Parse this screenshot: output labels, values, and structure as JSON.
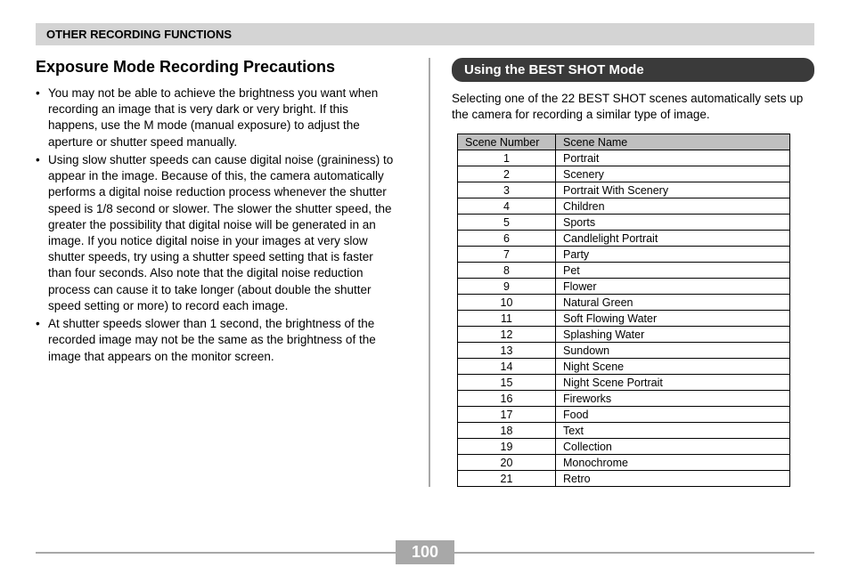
{
  "header": "OTHER RECORDING FUNCTIONS",
  "left": {
    "title": "Exposure Mode Recording Precautions",
    "bullets": [
      "You may not be able to achieve the brightness you want when recording an image that is very dark or very bright. If this happens, use the M mode (manual exposure) to adjust the aperture or shutter speed manually.",
      "Using slow shutter speeds can cause digital noise (graininess) to appear in the image. Because of this, the camera automatically performs a digital noise reduction process whenever the shutter speed is 1/8 second or slower. The slower the shutter speed, the greater the possibility that digital noise will be generated in an image. If you notice digital noise in your images at very slow shutter speeds, try using a shutter speed setting that is faster than four seconds. Also note that the digital noise reduction process can cause it to take longer (about double the shutter speed setting or more) to record each image.",
      "At shutter speeds slower than 1 second, the brightness of the recorded image may not be the same as the brightness of the image that appears on the monitor screen."
    ]
  },
  "right": {
    "subheader": "Using the BEST SHOT Mode",
    "intro": "Selecting one of the 22 BEST SHOT scenes automatically sets up the camera for recording a similar type of image.",
    "table": {
      "headers": [
        "Scene Number",
        "Scene Name"
      ],
      "rows": [
        [
          "1",
          "Portrait"
        ],
        [
          "2",
          "Scenery"
        ],
        [
          "3",
          "Portrait With Scenery"
        ],
        [
          "4",
          "Children"
        ],
        [
          "5",
          "Sports"
        ],
        [
          "6",
          "Candlelight Portrait"
        ],
        [
          "7",
          "Party"
        ],
        [
          "8",
          "Pet"
        ],
        [
          "9",
          "Flower"
        ],
        [
          "10",
          "Natural Green"
        ],
        [
          "11",
          "Soft Flowing Water"
        ],
        [
          "12",
          "Splashing Water"
        ],
        [
          "13",
          "Sundown"
        ],
        [
          "14",
          "Night Scene"
        ],
        [
          "15",
          "Night Scene Portrait"
        ],
        [
          "16",
          "Fireworks"
        ],
        [
          "17",
          "Food"
        ],
        [
          "18",
          "Text"
        ],
        [
          "19",
          "Collection"
        ],
        [
          "20",
          "Monochrome"
        ],
        [
          "21",
          "Retro"
        ]
      ]
    }
  },
  "page_number": "100"
}
